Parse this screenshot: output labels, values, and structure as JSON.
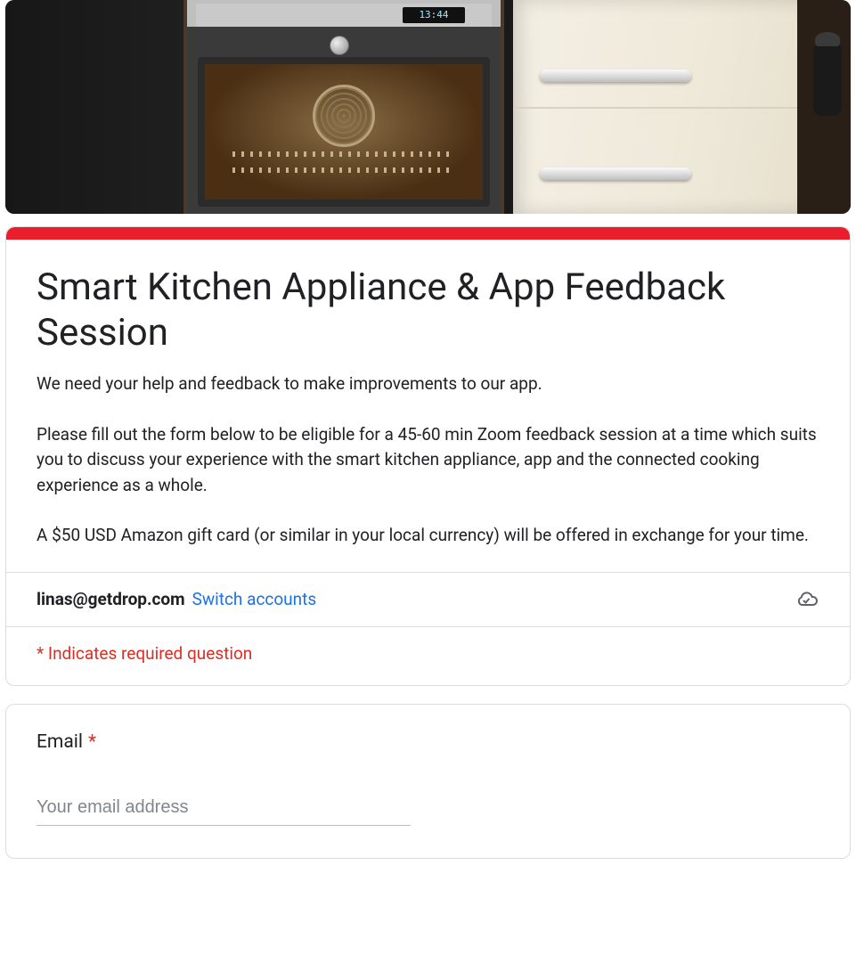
{
  "hero": {
    "clock": "13:44"
  },
  "form": {
    "title": "Smart Kitchen Appliance & App Feedback Session",
    "description": {
      "p1": "We need your help and feedback to make improvements to our app.",
      "p2": "Please fill out the form below to be eligible for a 45-60 min Zoom feedback session at a time which suits you to discuss your experience with the smart kitchen appliance, app and the connected cooking experience as a whole.",
      "p3": "A $50 USD Amazon gift card (or similar in your local currency) will be offered in exchange for your time."
    },
    "account": {
      "email": "linas@getdrop.com",
      "switch_label": "Switch accounts"
    },
    "required_note": "* Indicates required question",
    "questions": {
      "email": {
        "label": "Email",
        "placeholder": "Your email address",
        "value": ""
      }
    }
  },
  "colors": {
    "accent": "#ea1d2c",
    "link": "#1a73e8",
    "danger": "#d93025"
  }
}
